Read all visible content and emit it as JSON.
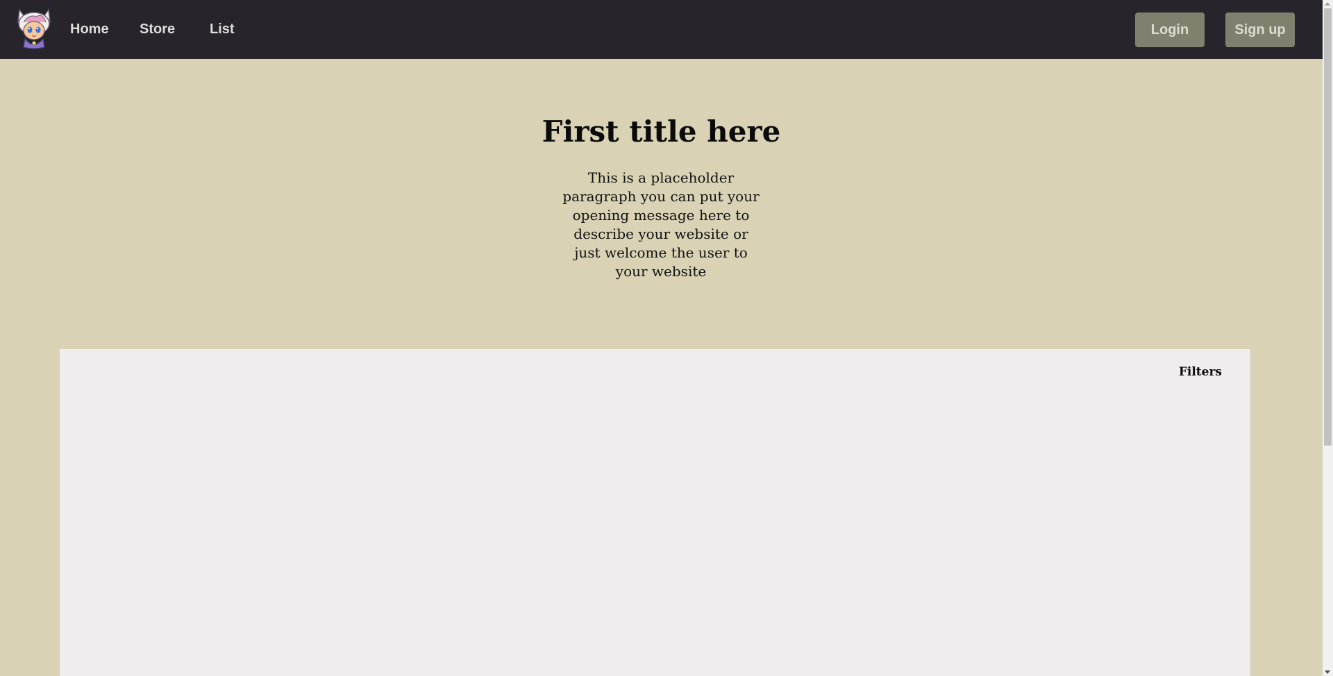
{
  "nav": {
    "logo_icon": "anime-mascot-logo",
    "links": [
      {
        "label": "Home"
      },
      {
        "label": "Store"
      },
      {
        "label": "List"
      }
    ],
    "login_label": "Login",
    "signup_label": "Sign up"
  },
  "hero": {
    "title": "First title here",
    "paragraph": "This is a placeholder paragraph you can put your opening message here to describe your website or just welcome the user to your website"
  },
  "panel": {
    "filters_label": "Filters"
  },
  "colors": {
    "navbar": "#27252b",
    "page_background": "#d9d2b5",
    "panel_background": "#efeded",
    "button": "#817f6d"
  }
}
